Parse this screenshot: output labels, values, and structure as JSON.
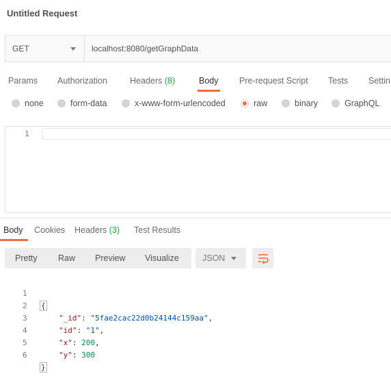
{
  "request": {
    "title": "Untitled Request",
    "method": "GET",
    "url": "localhost:8080/getGraphData"
  },
  "request_tabs": [
    {
      "label": "Params"
    },
    {
      "label": "Authorization"
    },
    {
      "label": "Headers",
      "count": "(8)"
    },
    {
      "label": "Body",
      "active": true
    },
    {
      "label": "Pre-request Script"
    },
    {
      "label": "Tests"
    },
    {
      "label": "Settin"
    }
  ],
  "body_types": [
    {
      "label": "none"
    },
    {
      "label": "form-data"
    },
    {
      "label": "x-www-form-urlencoded"
    },
    {
      "label": "raw",
      "selected": true
    },
    {
      "label": "binary"
    },
    {
      "label": "GraphQL"
    }
  ],
  "editor": {
    "line_number": "1"
  },
  "response_tabs": [
    {
      "label": "Body",
      "active": true
    },
    {
      "label": "Cookies"
    },
    {
      "label": "Headers",
      "count": "(3)"
    },
    {
      "label": "Test Results"
    }
  ],
  "view_modes": [
    "Pretty",
    "Raw",
    "Preview",
    "Visualize"
  ],
  "format": "JSON",
  "response_lines": [
    {
      "n": "1",
      "open": "{"
    },
    {
      "n": "2",
      "key": "\"_id\"",
      "val": "\"5fae2cac22d0b24144c159aa\"",
      "tail": ","
    },
    {
      "n": "3",
      "key": "\"id\"",
      "val": "\"1\"",
      "tail": ","
    },
    {
      "n": "4",
      "key": "\"x\"",
      "num": "200",
      "tail": ","
    },
    {
      "n": "5",
      "key": "\"y\"",
      "num": "300",
      "tail": ""
    },
    {
      "n": "6",
      "close": "}"
    }
  ],
  "colors": {
    "accent": "#f26b3a",
    "count_green": "#26a344"
  },
  "icons": {
    "method_dropdown": "chevron-down-icon",
    "wrap": "wrap-lines-icon"
  }
}
